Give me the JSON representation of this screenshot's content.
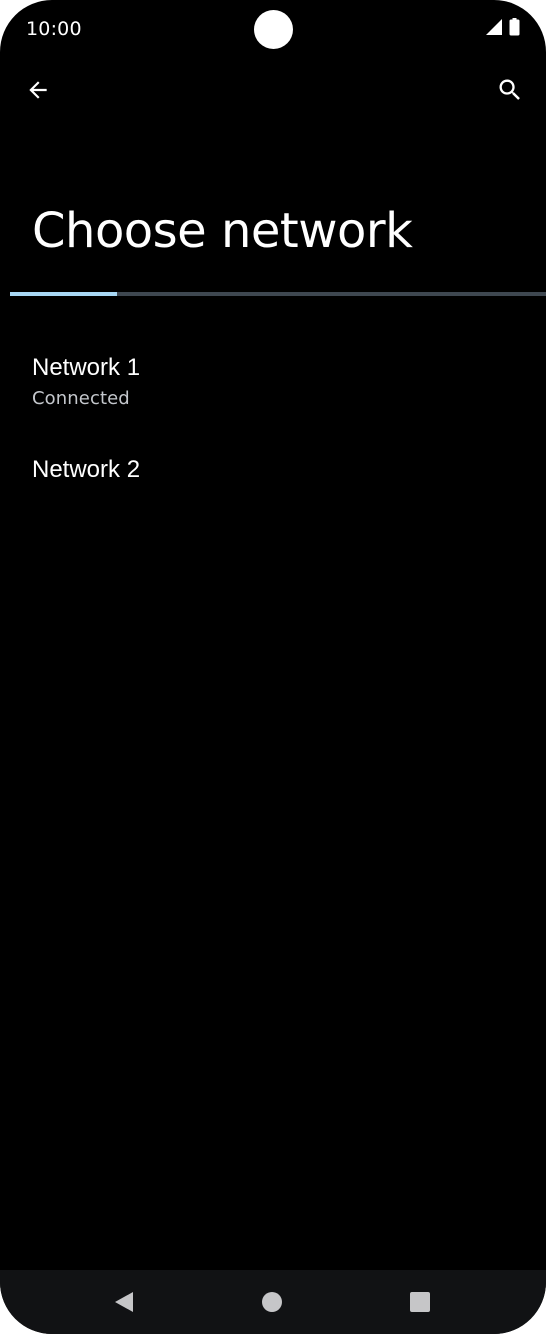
{
  "status_bar": {
    "time": "10:00",
    "icons": [
      "cellular-signal-icon",
      "battery-icon"
    ]
  },
  "top_bar": {
    "back_icon": "arrow-left-icon",
    "search_icon": "search-icon"
  },
  "page": {
    "title": "Choose network",
    "progress": 0.2
  },
  "networks": [
    {
      "name": "Network 1",
      "status": "Connected"
    },
    {
      "name": "Network 2",
      "status": ""
    }
  ],
  "nav_bar": {
    "icons": [
      "nav-back-icon",
      "nav-home-icon",
      "nav-recents-icon"
    ]
  },
  "colors": {
    "background": "#000000",
    "text_primary": "#ffffff",
    "text_secondary": "#c4c7cc",
    "progress_track": "#3e4750",
    "progress_fill": "#a8d8f5",
    "nav_bar": "#111214"
  }
}
